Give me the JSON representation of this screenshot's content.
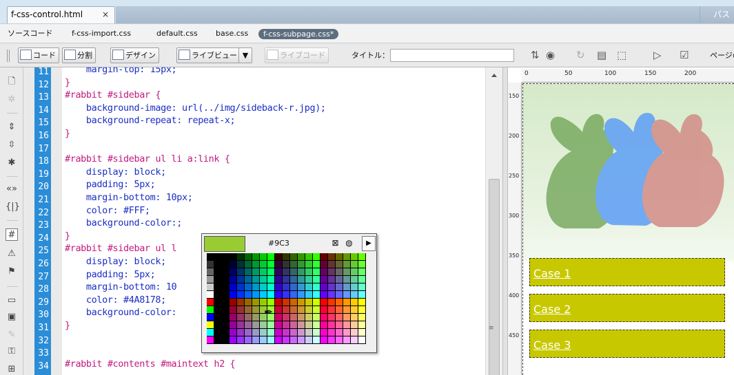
{
  "document_tab": {
    "label": "f-css-control.html",
    "close": "×"
  },
  "path_label": "パス",
  "related_files": [
    "ソースコード",
    "f-css-import.css",
    "default.css",
    "base.css",
    "f-css-subpage.css*"
  ],
  "toolbar": {
    "code_label": "コード",
    "split_label": "分割",
    "design_label": "デザイン",
    "liveview_label": "ライブビュー",
    "livecode_label": "ライブコード",
    "title_label": "タイトル：",
    "title_value": "",
    "page_label": "ページの"
  },
  "editor": {
    "lines": [
      {
        "n": "11",
        "text": "    margin-top: 15px;",
        "kind": "prop"
      },
      {
        "n": "12",
        "text": "}",
        "kind": "sel"
      },
      {
        "n": "13",
        "text": "#rabbit #sidebar {",
        "kind": "sel"
      },
      {
        "n": "14",
        "text": "    background-image: url(../img/sideback-r.jpg);",
        "kind": "prop"
      },
      {
        "n": "15",
        "text": "    background-repeat: repeat-x;",
        "kind": "prop"
      },
      {
        "n": "16",
        "text": "}",
        "kind": "sel"
      },
      {
        "n": "17",
        "text": "",
        "kind": "prop"
      },
      {
        "n": "18",
        "text": "#rabbit #sidebar ul li a:link {",
        "kind": "sel"
      },
      {
        "n": "19",
        "text": "    display: block;",
        "kind": "prop"
      },
      {
        "n": "20",
        "text": "    padding: 5px;",
        "kind": "prop"
      },
      {
        "n": "21",
        "text": "    margin-bottom: 10px;",
        "kind": "prop"
      },
      {
        "n": "22",
        "text": "    color: #FFF;",
        "kind": "prop"
      },
      {
        "n": "23",
        "text": "    background-color:;",
        "kind": "prop"
      },
      {
        "n": "24",
        "text": "}",
        "kind": "sel"
      },
      {
        "n": "25",
        "text": "#rabbit #sidebar ul l",
        "kind": "sel"
      },
      {
        "n": "26",
        "text": "    display: block;",
        "kind": "prop"
      },
      {
        "n": "27",
        "text": "    padding: 5px;",
        "kind": "prop"
      },
      {
        "n": "28",
        "text": "    margin-bottom: 10",
        "kind": "prop"
      },
      {
        "n": "29",
        "text": "    color: #4A8178;",
        "kind": "prop"
      },
      {
        "n": "30",
        "text": "    background-color:",
        "kind": "prop"
      },
      {
        "n": "31",
        "text": "}",
        "kind": "sel"
      },
      {
        "n": "32",
        "text": "",
        "kind": "prop"
      },
      {
        "n": "33",
        "text": "",
        "kind": "prop"
      },
      {
        "n": "34",
        "text": "#rabbit #contents #maintext h2 {",
        "kind": "sel"
      }
    ]
  },
  "color_picker": {
    "hex_value": "#9C3",
    "selected_color": "#99cc33",
    "default_color_icon": "no-color-icon",
    "system_color_icon": "system-color-icon",
    "menu_arrow_icon": "triangle-right-icon"
  },
  "design_view": {
    "ruler_top": [
      "0",
      "50",
      "100",
      "150",
      "200"
    ],
    "ruler_left": [
      "150",
      "200",
      "250",
      "300",
      "350",
      "400",
      "450"
    ],
    "cases": [
      "Case 1",
      "Case 2",
      "Case 3"
    ],
    "case_color": "#c8c800",
    "rabbit_colors": [
      "#7aab62",
      "#5d9ef5",
      "#d28c87"
    ]
  },
  "colors": {
    "line_gutter": "#2b8dd7",
    "selector": "#c2187e",
    "property": "#1b2ec4"
  }
}
